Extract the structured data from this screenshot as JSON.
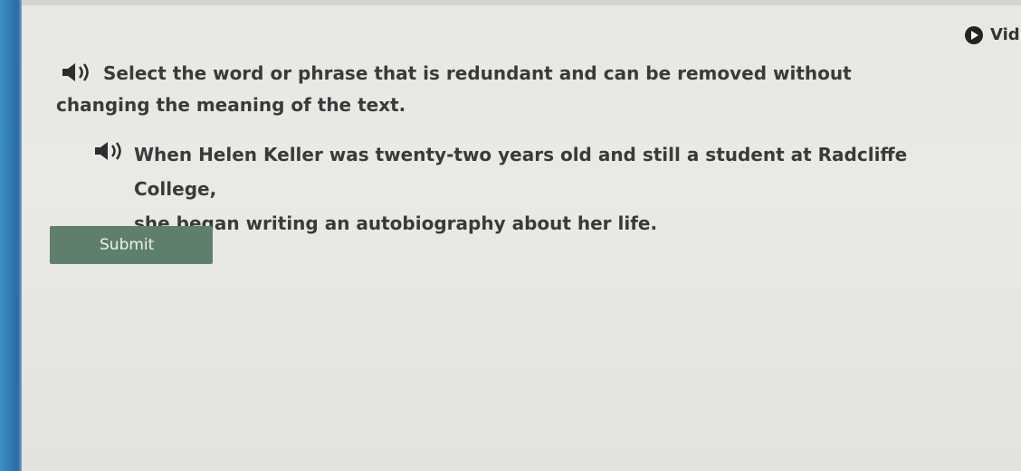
{
  "header": {
    "video_label": "Vid"
  },
  "question": {
    "instruction": "Select the word or phrase that is redundant and can be removed without changing the meaning of the text.",
    "sentence_line1": "When Helen Keller was twenty-two years old and still a student at Radcliffe College,",
    "sentence_line2": "she began writing an autobiography about her life."
  },
  "actions": {
    "submit_label": "Submit"
  },
  "icons": {
    "instruction_audio": "speaker-icon",
    "sentence_audio": "speaker-icon",
    "video": "play-icon"
  }
}
